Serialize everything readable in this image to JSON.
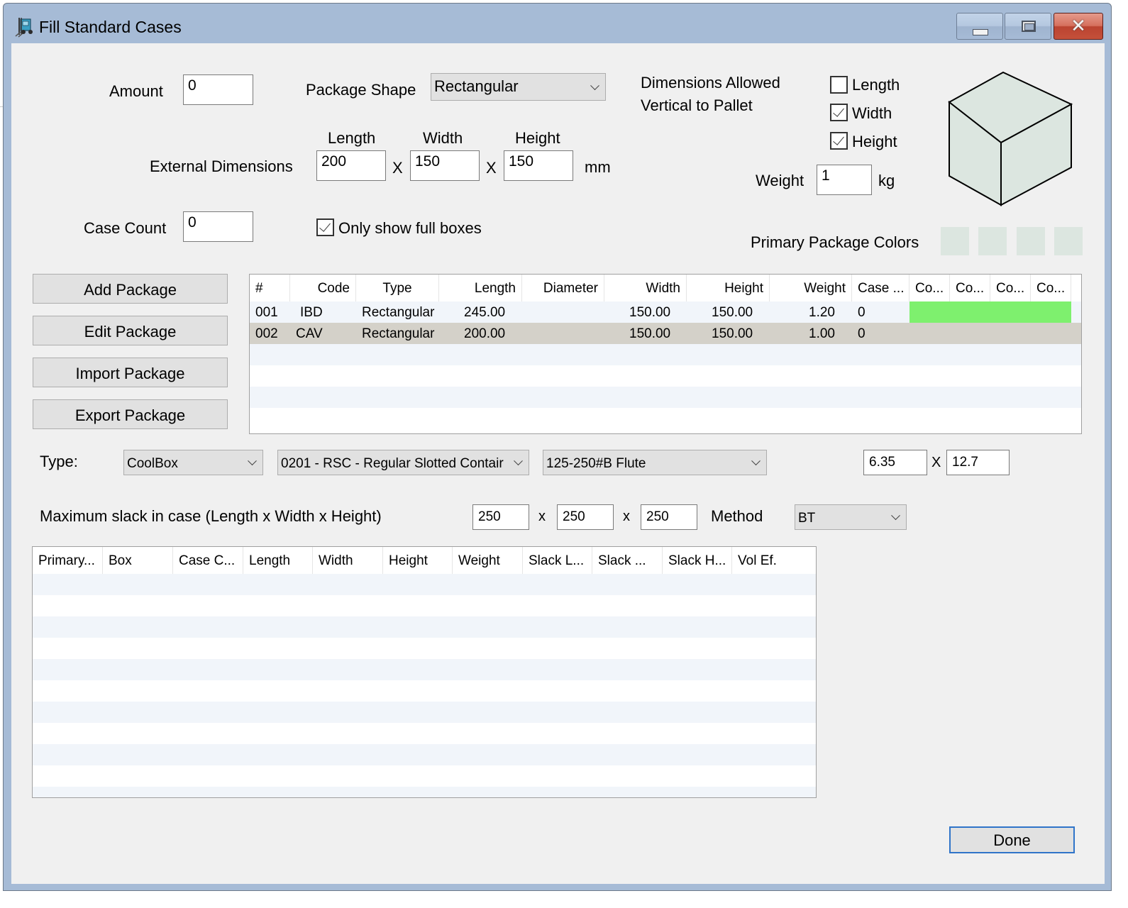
{
  "window": {
    "title": "Fill Standard Cases",
    "icon": "forklift-icon",
    "controls": {
      "minimize": "minimize-icon",
      "maximize": "maximize-icon",
      "close": "close-icon"
    }
  },
  "form": {
    "amount_label": "Amount",
    "amount_value": "0",
    "package_shape_label": "Package Shape",
    "package_shape_value": "Rectangular",
    "external_dimensions_label": "External Dimensions",
    "dim_headers": {
      "length": "Length",
      "width": "Width",
      "height": "Height"
    },
    "length_value": "200",
    "width_value": "150",
    "height_value": "150",
    "x_sep": "X",
    "unit_mm": "mm",
    "dimensions_allowed_line1": "Dimensions Allowed",
    "dimensions_allowed_line2": "Vertical to Pallet",
    "vertical_options": [
      {
        "label": "Length",
        "checked": false
      },
      {
        "label": "Width",
        "checked": true
      },
      {
        "label": "Height",
        "checked": true
      }
    ],
    "weight_label": "Weight",
    "weight_value": "1",
    "unit_kg": "kg",
    "case_count_label": "Case Count",
    "case_count_value": "0",
    "only_full_boxes_label": "Only show full boxes",
    "only_full_boxes_checked": true,
    "primary_colors_label": "Primary Package Colors",
    "primary_colors": [
      "#dce6e0",
      "#dce6e0",
      "#dce6e0",
      "#dce6e0"
    ],
    "preview_fill": "#dce6e0"
  },
  "buttons": {
    "add_package": "Add Package",
    "edit_package": "Edit Package",
    "import_package": "Import Package",
    "export_package": "Export Package",
    "done": "Done"
  },
  "packages_table": {
    "columns": [
      "#",
      "Code",
      "Type",
      "Length",
      "Diameter",
      "Width",
      "Height",
      "Weight",
      "Case ...",
      "Co...",
      "Co...",
      "Co...",
      "Co..."
    ],
    "rows": [
      {
        "num": "001",
        "code": "IBD",
        "type": "Rectangular",
        "length": "245.00",
        "diameter": "",
        "width": "150.00",
        "height": "150.00",
        "weight": "1.20",
        "case": "0",
        "color": "#7ef06e",
        "selected": false
      },
      {
        "num": "002",
        "code": "CAV",
        "type": "Rectangular",
        "length": "200.00",
        "diameter": "",
        "width": "150.00",
        "height": "150.00",
        "weight": "1.00",
        "case": "0",
        "color": "",
        "selected": true
      }
    ]
  },
  "type_row": {
    "label": "Type:",
    "box_type": "CoolBox",
    "style": "0201 - RSC - Regular Slotted Contair",
    "flute": "125-250#B Flute",
    "thickness_a": "6.35",
    "x_sep": "X",
    "thickness_b": "12.7"
  },
  "slack_row": {
    "label": "Maximum slack in case  (Length x Width x Height)",
    "length": "250",
    "width": "250",
    "height": "250",
    "x_sep": "x",
    "method_label": "Method",
    "method_value": "BT"
  },
  "results_table": {
    "columns": [
      "Primary...",
      "Box",
      "Case C...",
      "Length",
      "Width",
      "Height",
      "Weight",
      "Slack L...",
      "Slack ...",
      "Slack H...",
      "Vol Ef."
    ],
    "rows": []
  }
}
